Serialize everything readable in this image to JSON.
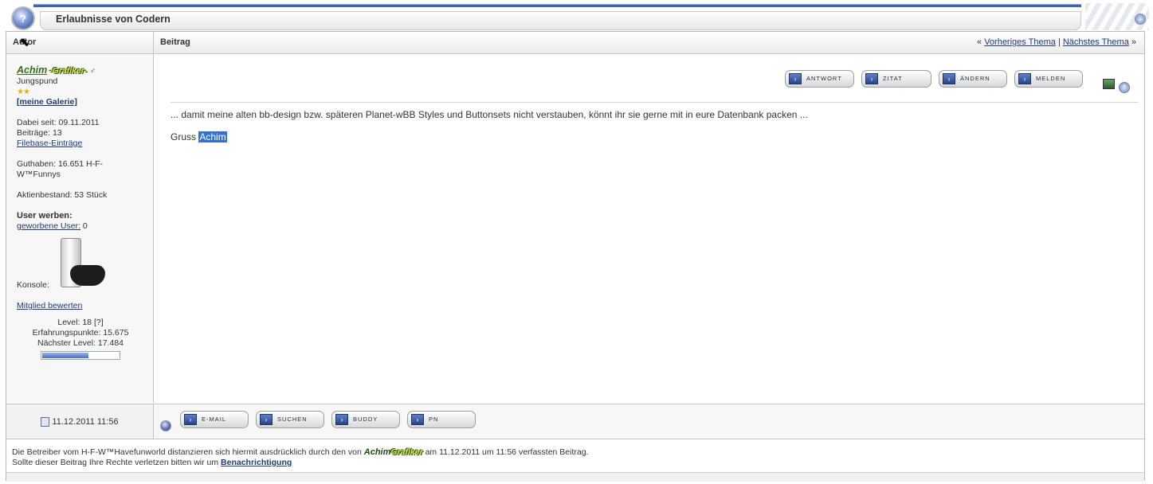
{
  "window": {
    "title": "Erlaubnisse von Codern",
    "help_icon": "help-icon",
    "collapse_icon": "chevron-down-icon"
  },
  "table": {
    "col_author": "Autor",
    "col_post": "Beitrag",
    "nav": {
      "prefix": "«",
      "prev": "Vorheriges Thema",
      "sep": "|",
      "next": "Nächstes Thema",
      "suffix": "»"
    }
  },
  "author": {
    "name": "Achim",
    "badge": "Grafiker",
    "dash_left": "-",
    "dash_right": "-",
    "gender_icon": "♂",
    "rank": "Jungspund",
    "stars": "★★",
    "gallery": "[meine Galerie]",
    "joined_label": "Dabei seit:",
    "joined": "09.11.2011",
    "posts_label": "Beiträge:",
    "posts": "13",
    "filebase": "Filebase-Einträge",
    "credit_label": "Guthaben:",
    "credit_value": "16.651 H-F-W™Funnys",
    "stock_label": "Aktienbestand:",
    "stock_value": "53 Stück",
    "refer_label": "User werben:",
    "referred_link": "geworbene User:",
    "referred_count": "0",
    "console_label": "Konsole:",
    "rate_link": "Mitglied bewerten",
    "level_label": "Level:",
    "level": "18",
    "level_help": "[?]",
    "xp_label": "Erfahrungspunkte:",
    "xp": "15.675",
    "next_label": "Nächster Level:",
    "next": "17.484",
    "level_progress": 0.6
  },
  "post": {
    "message": "... damit meine alten bb-design bzw. späteren Planet-wBB Styles und Buttonsets nicht verstauben, könnt ihr sie gerne mit in eure Datenbank packen ...",
    "greeting": "Gruss",
    "greeting_name": "Achim",
    "buttons": [
      {
        "label": "ANTWORT",
        "icon": "reply-icon"
      },
      {
        "label": "ZITAT",
        "icon": "quote-icon"
      },
      {
        "label": "ÄNDERN",
        "icon": "edit-icon"
      },
      {
        "label": "MELDEN",
        "icon": "report-icon"
      }
    ],
    "footer_buttons": [
      {
        "label": "E-MAIL",
        "icon": "email-icon"
      },
      {
        "label": "SUCHEN",
        "icon": "search-icon"
      },
      {
        "label": "BUDDY",
        "icon": "buddy-icon"
      },
      {
        "label": "PN",
        "icon": "pm-icon"
      }
    ],
    "date": "11.12.2011 11:56"
  },
  "disclaimer": {
    "line1_a": "Die Betreiber vom H-F-W™Havefunworld distanzieren sich hiermit ausdrücklich durch den von",
    "line1_name": "Achim",
    "line1_badge": "Grafiker",
    "line1_b": "am 11.12.2011 um",
    "line1_time": "11:56",
    "line1_c": "verfassten Beitrag.",
    "line2": "Sollte dieser Beitrag Ihre Rechte verletzen bitten wir um",
    "line2_link": "Benachrichtigung"
  }
}
